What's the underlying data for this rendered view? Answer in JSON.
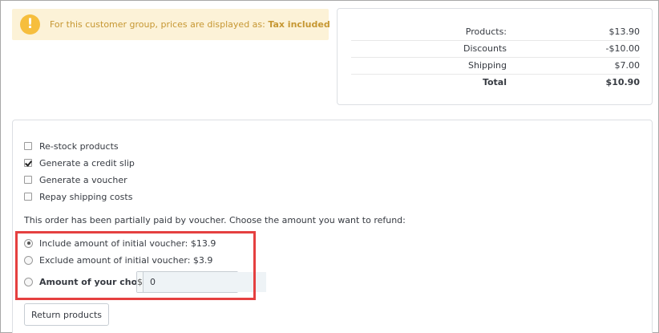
{
  "alert": {
    "icon": "!",
    "text_prefix": "For this customer group, prices are displayed as: ",
    "text_bold": "Tax included"
  },
  "totals": {
    "rows": [
      {
        "label": "Products:",
        "value": "$13.90"
      },
      {
        "label": "Discounts",
        "value": "-$10.00"
      },
      {
        "label": "Shipping",
        "value": "$7.00"
      },
      {
        "label": "Total",
        "value": "$10.90"
      }
    ]
  },
  "refund": {
    "options": [
      {
        "label": "Re-stock products",
        "checked": false
      },
      {
        "label": "Generate a credit slip",
        "checked": true
      },
      {
        "label": "Generate a voucher",
        "checked": false
      },
      {
        "label": "Repay shipping costs",
        "checked": false
      }
    ],
    "voucher_info": "This order has been partially paid by voucher. Choose the amount you want to refund:",
    "radios": [
      {
        "label": "Include amount of initial voucher: $13.9",
        "checked": true
      },
      {
        "label": "Exclude amount of initial voucher: $3.9",
        "checked": false
      },
      {
        "label": "Amount of your choice:",
        "checked": false
      }
    ],
    "currency_symbol": "$",
    "amount_value": "0",
    "submit_label": "Return products"
  },
  "colors": {
    "alert_bg": "#fcf2d7",
    "alert_icon": "#f6be3d",
    "alert_text": "#c69732",
    "highlight": "#e54040"
  }
}
